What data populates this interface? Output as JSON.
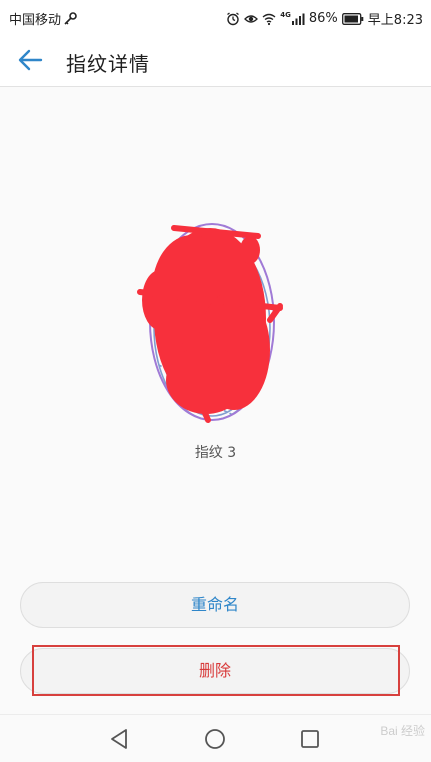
{
  "status_bar": {
    "carrier": "中国移动",
    "network_type": "4G",
    "battery_percent": "86%",
    "time": "早上8:23",
    "icons": [
      "key-icon",
      "alarm-icon",
      "eye-icon",
      "wifi-icon",
      "signal-icon",
      "battery-icon"
    ]
  },
  "app_bar": {
    "title": "指纹详情",
    "back_icon": "arrow-left-icon",
    "accent_color": "#2f86c9"
  },
  "fingerprint": {
    "label": "指纹 3",
    "icon": "fingerprint-icon",
    "redaction_color": "#f7303c"
  },
  "actions": {
    "rename_label": "重命名",
    "delete_label": "删除",
    "rename_color": "#2f86c9",
    "delete_color": "#d83a3a"
  },
  "nav_bar": {
    "icons": [
      "back-triangle-icon",
      "home-circle-icon",
      "recents-square-icon"
    ]
  },
  "watermark": {
    "text": "Bai 经验"
  }
}
